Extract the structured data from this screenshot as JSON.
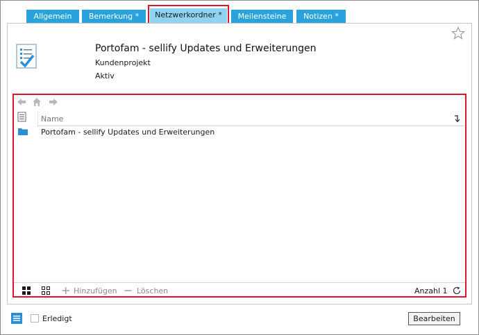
{
  "tabs": [
    {
      "label": "Allgemein"
    },
    {
      "label": "Bemerkung *"
    },
    {
      "label": "Netzwerkordner *"
    },
    {
      "label": "Meilensteine"
    },
    {
      "label": "Notizen *"
    }
  ],
  "project": {
    "title": "Portofam - sellify Updates und Erweiterungen",
    "type": "Kundenprojekt",
    "status": "Aktiv"
  },
  "browser": {
    "column_name": "Name",
    "rows": [
      {
        "name": "Portofam - sellify Updates und Erweiterungen"
      }
    ],
    "add_label": "Hinzufügen",
    "delete_label": "Löschen",
    "count_label": "Anzahl 1"
  },
  "footer": {
    "done_label": "Erledigt",
    "edit_label": "Bearbeiten"
  },
  "colors": {
    "tab": "#29a3de",
    "tab_active": "#8ed4f2",
    "highlight": "#e0142b",
    "icon_blue": "#2a8fd6"
  }
}
